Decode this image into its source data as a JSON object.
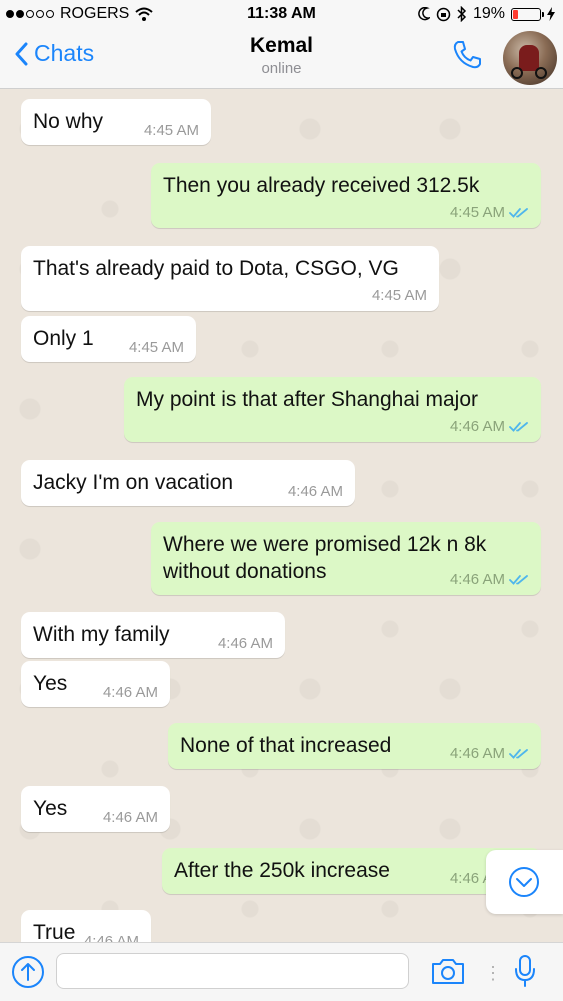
{
  "status_bar": {
    "carrier": "ROGERS",
    "time": "11:38 AM",
    "battery": "19%",
    "battery_level": 0.19,
    "signal_icon": "signal-dots-icon",
    "wifi_icon": "wifi-icon"
  },
  "header": {
    "back_label": "Chats",
    "contact_name": "Kemal",
    "contact_status": "online",
    "call_icon": "phone-icon",
    "avatar": "contact-avatar"
  },
  "colors": {
    "accent": "#1b85fb",
    "incoming_bubble": "#ffffff",
    "outgoing_bubble": "#dcf8c6",
    "read_ticks": "#4fb6ec",
    "battery_low": "#ff3b30"
  },
  "messages": [
    {
      "dir": "in",
      "text": "No why",
      "time": "4:45 AM"
    },
    {
      "dir": "out",
      "text": "Then you already received 312.5k",
      "time": "4:45 AM",
      "read": true
    },
    {
      "dir": "in",
      "text": "That's already paid to Dota, CSGO, VG",
      "time": "4:45 AM"
    },
    {
      "dir": "in",
      "text": "Only 1",
      "time": "4:45 AM"
    },
    {
      "dir": "out",
      "text": "My point is that after Shanghai major",
      "time": "4:46 AM",
      "read": true
    },
    {
      "dir": "in",
      "text": "Jacky I'm on vacation",
      "time": "4:46 AM"
    },
    {
      "dir": "out",
      "text": "Where we were promised 12k n 8k without donations",
      "time": "4:46 AM",
      "read": true
    },
    {
      "dir": "in",
      "text": "With my family",
      "time": "4:46 AM"
    },
    {
      "dir": "in",
      "text": "Yes",
      "time": "4:46 AM"
    },
    {
      "dir": "out",
      "text": "None of that increased",
      "time": "4:46 AM",
      "read": true
    },
    {
      "dir": "in",
      "text": "Yes",
      "time": "4:46 AM"
    },
    {
      "dir": "out",
      "text": "After the 250k increase",
      "time": "4:46 AM",
      "read": true
    },
    {
      "dir": "in",
      "text": "True",
      "time": "4:46 AM"
    }
  ],
  "input_bar": {
    "attach_icon": "upload-arrow-icon",
    "message_placeholder": "",
    "camera_icon": "camera-icon",
    "mic_icon": "microphone-icon"
  },
  "scroll_button_icon": "scroll-down-chevron-icon"
}
